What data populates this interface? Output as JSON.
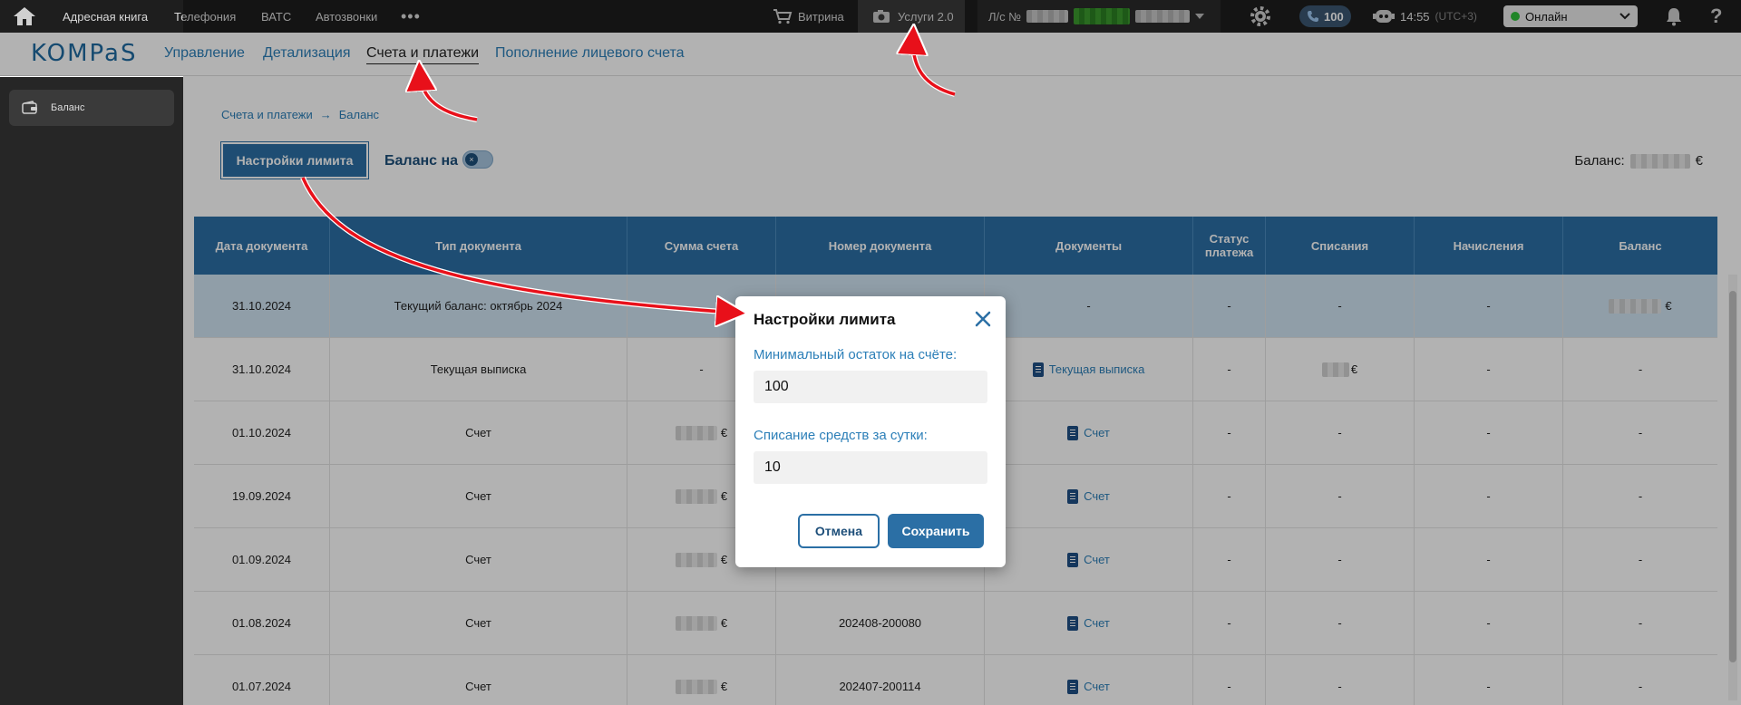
{
  "topbar": {
    "nav": [
      "Адресная книга",
      "Телефония",
      "ВАТС",
      "Автозвонки"
    ],
    "more": "•••",
    "storefront": "Витрина",
    "services": "Услуги 2.0",
    "account_prefix": "Л/с №",
    "calls_count": "100",
    "time": "14:55",
    "timezone": "(UTC+3)",
    "status": "Онлайн",
    "help": "?"
  },
  "subheader": {
    "logo": "KOMPaS",
    "tabs": [
      "Управление",
      "Детализация",
      "Счета и платежи",
      "Пополнение лицевого счета"
    ],
    "active_tab": "Счета и платежи"
  },
  "sidebar": {
    "items": [
      {
        "label": "Баланс"
      }
    ]
  },
  "breadcrumb": {
    "parent": "Счета и платежи",
    "separator": "→",
    "current": "Баланс"
  },
  "toolbar": {
    "limit_button": "Настройки лимита",
    "balance_toggle_label": "Баланс на",
    "toggle_knob": "×",
    "balance_label": "Баланс:",
    "currency": "€"
  },
  "table": {
    "headers": [
      "Дата документа",
      "Тип документа",
      "Сумма счета",
      "Номер документа",
      "Документы",
      "Статус платежа",
      "Списания",
      "Начисления",
      "Баланс"
    ],
    "rows": [
      [
        "31.10.2024",
        "Текущий баланс: октябрь 2024",
        "",
        "",
        "-",
        "-",
        "-",
        "-",
        "€"
      ],
      [
        "31.10.2024",
        "Текущая выписка",
        "-",
        "",
        "Текущая выписка",
        "-",
        "€",
        "-",
        "-"
      ],
      [
        "01.10.2024",
        "Счет",
        "€",
        "",
        "Счет",
        "-",
        "-",
        "-",
        "-"
      ],
      [
        "19.09.2024",
        "Счет",
        "€",
        "",
        "Счет",
        "-",
        "-",
        "-",
        "-"
      ],
      [
        "01.09.2024",
        "Счет",
        "€",
        "",
        "Счет",
        "-",
        "-",
        "-",
        "-"
      ],
      [
        "01.08.2024",
        "Счет",
        "€",
        "202408-200080",
        "Счет",
        "-",
        "-",
        "-",
        "-"
      ],
      [
        "01.07.2024",
        "Счет",
        "€",
        "202407-200114",
        "Счет",
        "-",
        "-",
        "-",
        "-"
      ]
    ]
  },
  "dialog": {
    "title": "Настройки лимита",
    "min_balance_label": "Минимальный остаток на счёте:",
    "min_balance_value": "100",
    "daily_charge_label": "Списание средств за сутки:",
    "daily_charge_value": "10",
    "cancel": "Отмена",
    "save": "Сохранить"
  },
  "colors": {
    "primary": "#2b6fa5",
    "link": "#2c7fb8",
    "annotation_arrow": "#e8101a"
  }
}
